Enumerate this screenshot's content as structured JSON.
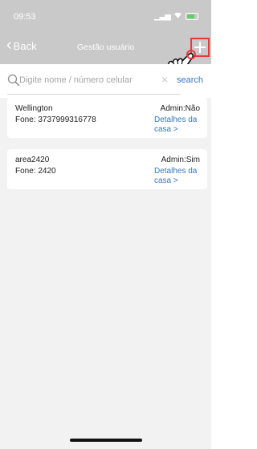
{
  "status_bar": {
    "time": "09:53"
  },
  "header": {
    "back_label": "Back",
    "title": "Gestão usuário",
    "add_label": "+"
  },
  "search": {
    "placeholder": "Digite nome / número celular",
    "clear_label": "×",
    "button_label": "search"
  },
  "users": [
    {
      "name": "Wellington",
      "phone": "Fone: 3737999316778",
      "admin": "Admin:Não",
      "link_label": "Detalhes da casa >"
    },
    {
      "name": "area2420",
      "phone": "Fone: 2420",
      "admin": "Admin:Sim",
      "link_label": "Detalhes da casa >"
    }
  ],
  "colors": {
    "header_bg": "#c9c9c9",
    "accent_link": "#3478c6",
    "highlight": "#e53a3a",
    "list_bg": "#f2f2f2"
  },
  "icons": [
    "signal-icon",
    "wifi-icon",
    "battery-icon",
    "back-chevron-icon",
    "plus-icon",
    "hand-pointer-icon",
    "search-icon",
    "clear-icon"
  ]
}
